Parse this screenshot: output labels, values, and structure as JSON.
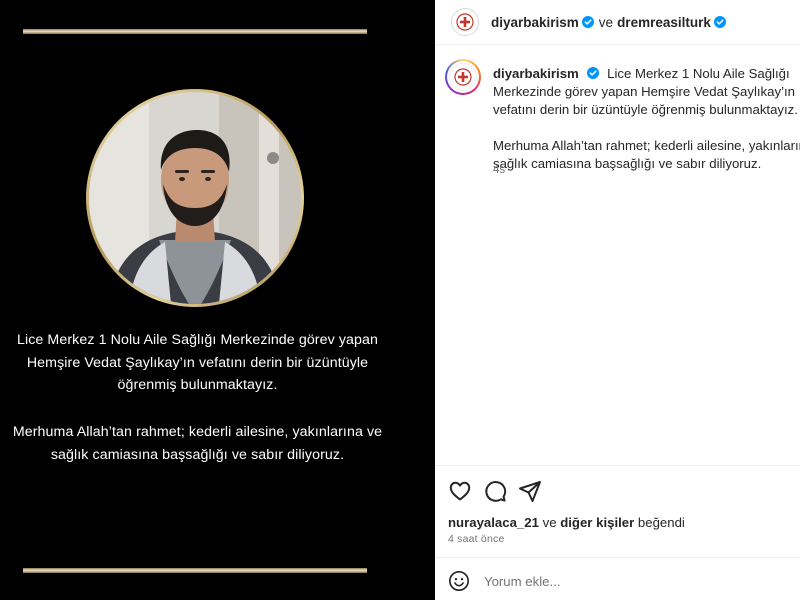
{
  "post_image": {
    "caption_paragraph_1": [
      "Lice Merkez 1 Nolu Aile Sağlığı Merkezinde görev yapan",
      "Hemşire Vedat Şaylıkay’ın vefatını derin bir üzüntüyle",
      "öğrenmiş bulunmaktayız."
    ],
    "caption_paragraph_2": [
      "Merhuma Allah’tan rahmet; kederli ailesine, yakınlarına ve",
      "sağlık camiasına başsağlığı ve sabır diliyoruz."
    ]
  },
  "header": {
    "author": "diyarbakirism",
    "connector": "ve",
    "collaborator": "dremreasilturk"
  },
  "caption": {
    "author": "diyarbakirism",
    "paragraph_1": "Lice Merkez 1 Nolu Aile Sağlığı Merkezinde görev yapan Hemşire Vedat Şaylıkay’ın vefatını derin bir üzüntüyle öğrenmiş bulunmaktayız.",
    "paragraph_2": "Merhuma Allah’tan rahmet; kederli ailesine, yakınlarına ve sağlık camiasına başsağlığı ve sabır diliyoruz.",
    "time": "4s"
  },
  "actions": {
    "icons": [
      "heart-icon",
      "comment-icon",
      "share-icon"
    ]
  },
  "likes": {
    "first_liker": "nurayalaca_21",
    "connector": "ve",
    "others": "diğer kişiler",
    "suffix": "beğendi",
    "time": "4 saat önce"
  },
  "comment_box": {
    "placeholder": "Yorum ekle..."
  },
  "colors": {
    "background_image": "#000000",
    "gold": "#d8c99e",
    "verified_badge": "#0095f6",
    "text_primary": "#262626",
    "text_secondary": "#737373"
  }
}
